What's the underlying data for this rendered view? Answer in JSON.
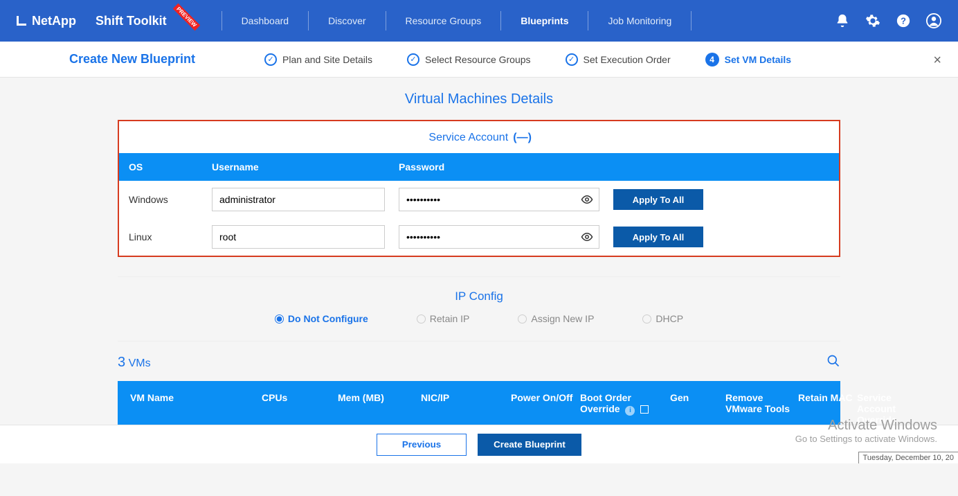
{
  "brand": "NetApp",
  "product": "Shift Toolkit",
  "preview_badge": "PREVIEW",
  "nav": {
    "dashboard": "Dashboard",
    "discover": "Discover",
    "resource_groups": "Resource Groups",
    "blueprints": "Blueprints",
    "job_monitoring": "Job Monitoring"
  },
  "subheader": {
    "title": "Create New Blueprint",
    "steps": {
      "s1": "Plan and Site Details",
      "s2": "Select Resource Groups",
      "s3": "Set Execution Order",
      "s4_num": "4",
      "s4": "Set VM Details"
    }
  },
  "vm_details_title": "Virtual Machines Details",
  "service_account": {
    "title": "Service Account",
    "collapse_glyph": "(—)",
    "headers": {
      "os": "OS",
      "username": "Username",
      "password": "Password"
    },
    "rows": [
      {
        "os": "Windows",
        "username": "administrator",
        "password": "••••••••••",
        "apply": "Apply To All"
      },
      {
        "os": "Linux",
        "username": "root",
        "password": "••••••••••",
        "apply": "Apply To All"
      }
    ]
  },
  "ip_config": {
    "title": "IP Config",
    "options": {
      "no_conf": "Do Not Configure",
      "retain": "Retain IP",
      "assign": "Assign New IP",
      "dhcp": "DHCP"
    }
  },
  "vms": {
    "count": "3",
    "label": "VMs",
    "headers": {
      "name": "VM Name",
      "cpus": "CPUs",
      "mem": "Mem (MB)",
      "nic": "NIC/IP",
      "power": "Power On/Off",
      "boot": "Boot Order Override",
      "gen": "Gen",
      "remove_tools": "Remove VMware Tools",
      "retain_mac": "Retain MAC",
      "svc_override": "Service Account Override"
    }
  },
  "bottom": {
    "previous": "Previous",
    "create": "Create Blueprint"
  },
  "watermark": {
    "l1": "Activate Windows",
    "l2": "Go to Settings to activate Windows."
  },
  "date_strip": "Tuesday, December 10, 20"
}
